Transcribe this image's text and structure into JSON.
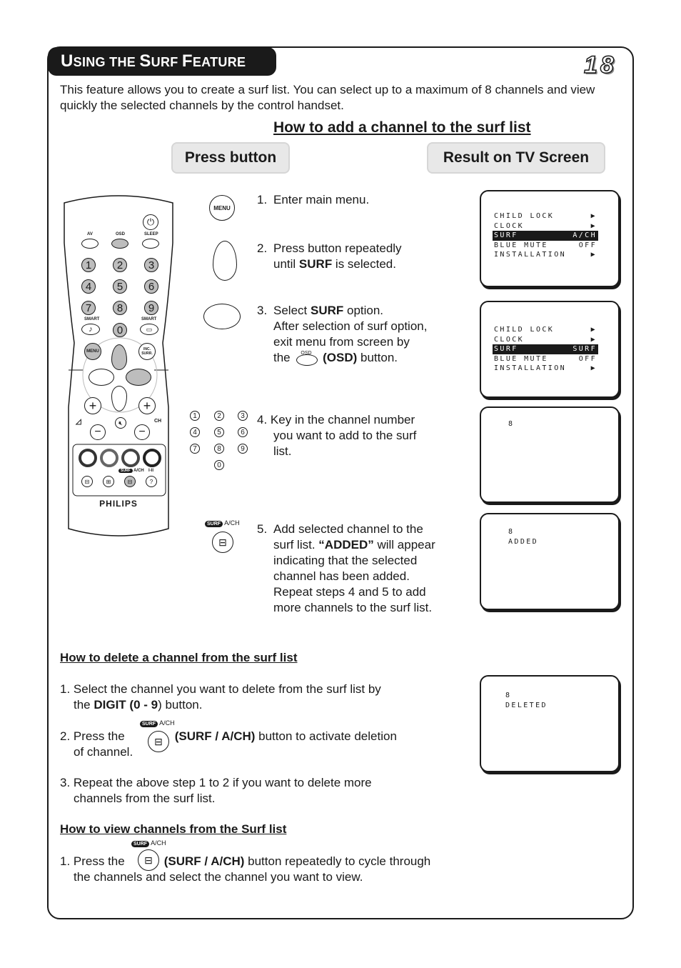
{
  "page": {
    "title_parts": [
      {
        "cap": "U",
        "rest": "SING THE "
      },
      {
        "cap": "S",
        "rest": "URF "
      },
      {
        "cap": "F",
        "rest": "EATURE"
      }
    ],
    "page_number": "18",
    "intro": "This feature allows you to create a surf list. You can select up to a maximum of 8 channels and view quickly the selected channels by the control handset."
  },
  "add_section": {
    "heading": "How to add a channel to the surf list",
    "press_button_label": "Press button",
    "result_label": "Result on TV Screen",
    "steps": [
      {
        "num": "1.",
        "text": "Enter main menu.",
        "icon": "menu-button-icon",
        "icon_label": "MENU"
      },
      {
        "num": "2.",
        "line1": "Press button repeatedly",
        "line2_pre": "until ",
        "line2_bold": "SURF",
        "line2_post": " is selected.",
        "icon": "down-arrow-button-icon"
      },
      {
        "num": "3.",
        "line1_pre": "Select ",
        "line1_bold": "SURF",
        "line1_post": " option.",
        "line2": "After selection of surf option,",
        "line3": "exit menu from screen by",
        "line4_pre": "the",
        "line4_icon_label": "OSD",
        "line4_bold": "(OSD)",
        "line4_post": " button.",
        "icon": "right-arrow-button-icon"
      },
      {
        "num": "4.",
        "line1": "Key in the channel number",
        "line2": "you want to add to the surf",
        "line3": "list.",
        "icon": "digit-keypad-icon",
        "digits": [
          "1",
          "2",
          "3",
          "4",
          "5",
          "6",
          "7",
          "8",
          "9",
          "0"
        ]
      },
      {
        "num": "5.",
        "line1": "Add selected channel to the",
        "line2_pre": "surf list. ",
        "line2_bold": "“ADDED”",
        "line2_post": " will appear",
        "line3": "indicating that the selected",
        "line4": "channel has been added.",
        "line5": "Repeat steps 4 and 5 to add",
        "line6": "more channels to the surf list.",
        "icon": "surf-ach-button-icon",
        "badge": "SURF",
        "badge_label": "A/CH"
      }
    ],
    "screens": [
      {
        "type": "menu",
        "rows": [
          {
            "label": "CHILD LOCK",
            "value": "▶",
            "selected": false
          },
          {
            "label": "CLOCK",
            "value": "▶",
            "selected": false
          },
          {
            "label": "SURF",
            "value": "A/CH",
            "selected": true
          },
          {
            "label": "BLUE MUTE",
            "value": "OFF",
            "selected": false
          },
          {
            "label": "INSTALLATION",
            "value": "▶",
            "selected": false
          }
        ]
      },
      {
        "type": "menu",
        "rows": [
          {
            "label": "CHILD LOCK",
            "value": "▶",
            "selected": false
          },
          {
            "label": "CLOCK",
            "value": "▶",
            "selected": false
          },
          {
            "label": "SURF",
            "value": "SURF",
            "selected": true
          },
          {
            "label": "BLUE MUTE",
            "value": "OFF",
            "selected": false
          },
          {
            "label": "INSTALLATION",
            "value": "▶",
            "selected": false
          }
        ]
      },
      {
        "type": "text",
        "line1": "8",
        "line2": ""
      },
      {
        "type": "text",
        "line1": "8",
        "line2": "ADDED"
      }
    ]
  },
  "remote": {
    "brand": "PHILIPS",
    "top_labels": [
      "AV",
      "OSD",
      "SLEEP"
    ],
    "digits": [
      "1",
      "2",
      "3",
      "4",
      "5",
      "6",
      "7",
      "8",
      "9"
    ],
    "smart_label": "SMART",
    "zero": "0",
    "menu": "MENU",
    "inc_surr": [
      "INC.",
      "SURR."
    ],
    "ch_label": "CH",
    "surf_badge": "SURF",
    "ach_label": "A/CH",
    "i_ii_label": "I-II"
  },
  "delete_section": {
    "heading": "How to delete a channel from the surf list",
    "step1_line1": "1. Select the channel you want to delete from the surf list by",
    "step1_line2_pre": "the ",
    "step1_line2_bold": "DIGIT (0 - 9",
    "step1_line2_post": ") button.",
    "step2_pre": "2. Press the",
    "step2_bold": "(SURF / A/CH)",
    "step2_post": " button to activate deletion",
    "step2_line2": "of channel.",
    "step3_line1": "3. Repeat the above step 1 to 2 if you want to delete more",
    "step3_line2": "channels from the surf list.",
    "screen": {
      "line1": "8",
      "line2": "DELETED"
    }
  },
  "view_section": {
    "heading": "How to view channels from the Surf list",
    "step1_pre": "1. Press the",
    "step1_bold": "(SURF / A/CH)",
    "step1_post": " button repeatedly to cycle through",
    "step1_line2": "the channels and select the channel you want to view."
  },
  "badge": {
    "surf": "SURF",
    "ach": "A/CH"
  }
}
